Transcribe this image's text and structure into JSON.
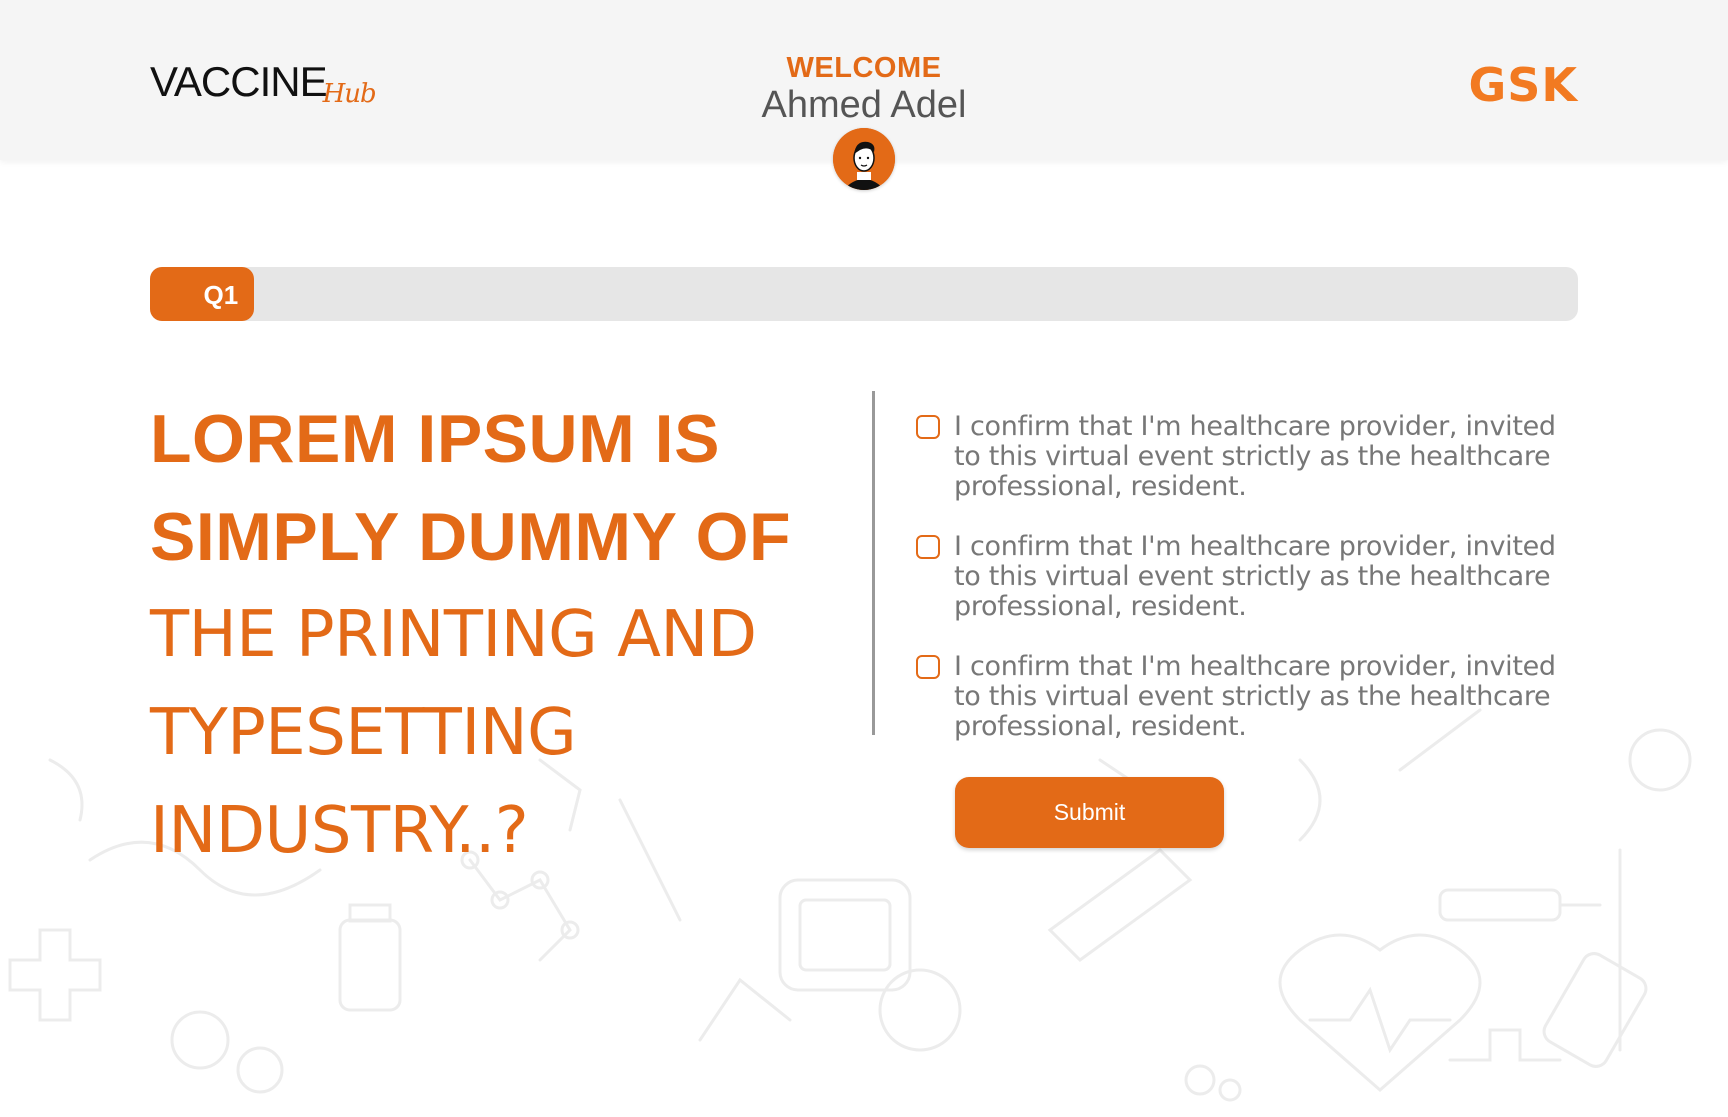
{
  "header": {
    "logo_main": "VACCINE",
    "logo_sub": "Hub",
    "welcome_label": "WELCOME",
    "user_name": "Ahmed Adel",
    "brand_logo": "GSK"
  },
  "progress": {
    "label": "Q1",
    "fraction": 0.073
  },
  "question": {
    "line1": "LOREM IPSUM IS",
    "line2": "SIMPLY DUMMY OF",
    "line3": "THE PRINTING AND",
    "line4": "TYPESETTING",
    "line5": "INDUSTRY..?"
  },
  "options": [
    {
      "text": "I confirm that I'm healthcare provider, invited to this virtual event strictly as the healthcare professional, resident.",
      "checked": false
    },
    {
      "text": "I confirm that I'm healthcare provider, invited to this virtual event strictly as the healthcare professional, resident.",
      "checked": false
    },
    {
      "text": "I confirm that I'm healthcare provider, invited to this virtual event strictly as the healthcare professional, resident.",
      "checked": false
    }
  ],
  "submit_label": "Submit",
  "colors": {
    "accent": "#e36a17",
    "brand_gsk": "#f27a21",
    "track": "#e6e6e6",
    "header_bg": "#f5f5f5"
  },
  "icons": {
    "avatar": "user-avatar-icon",
    "checkbox": "checkbox-icon"
  }
}
